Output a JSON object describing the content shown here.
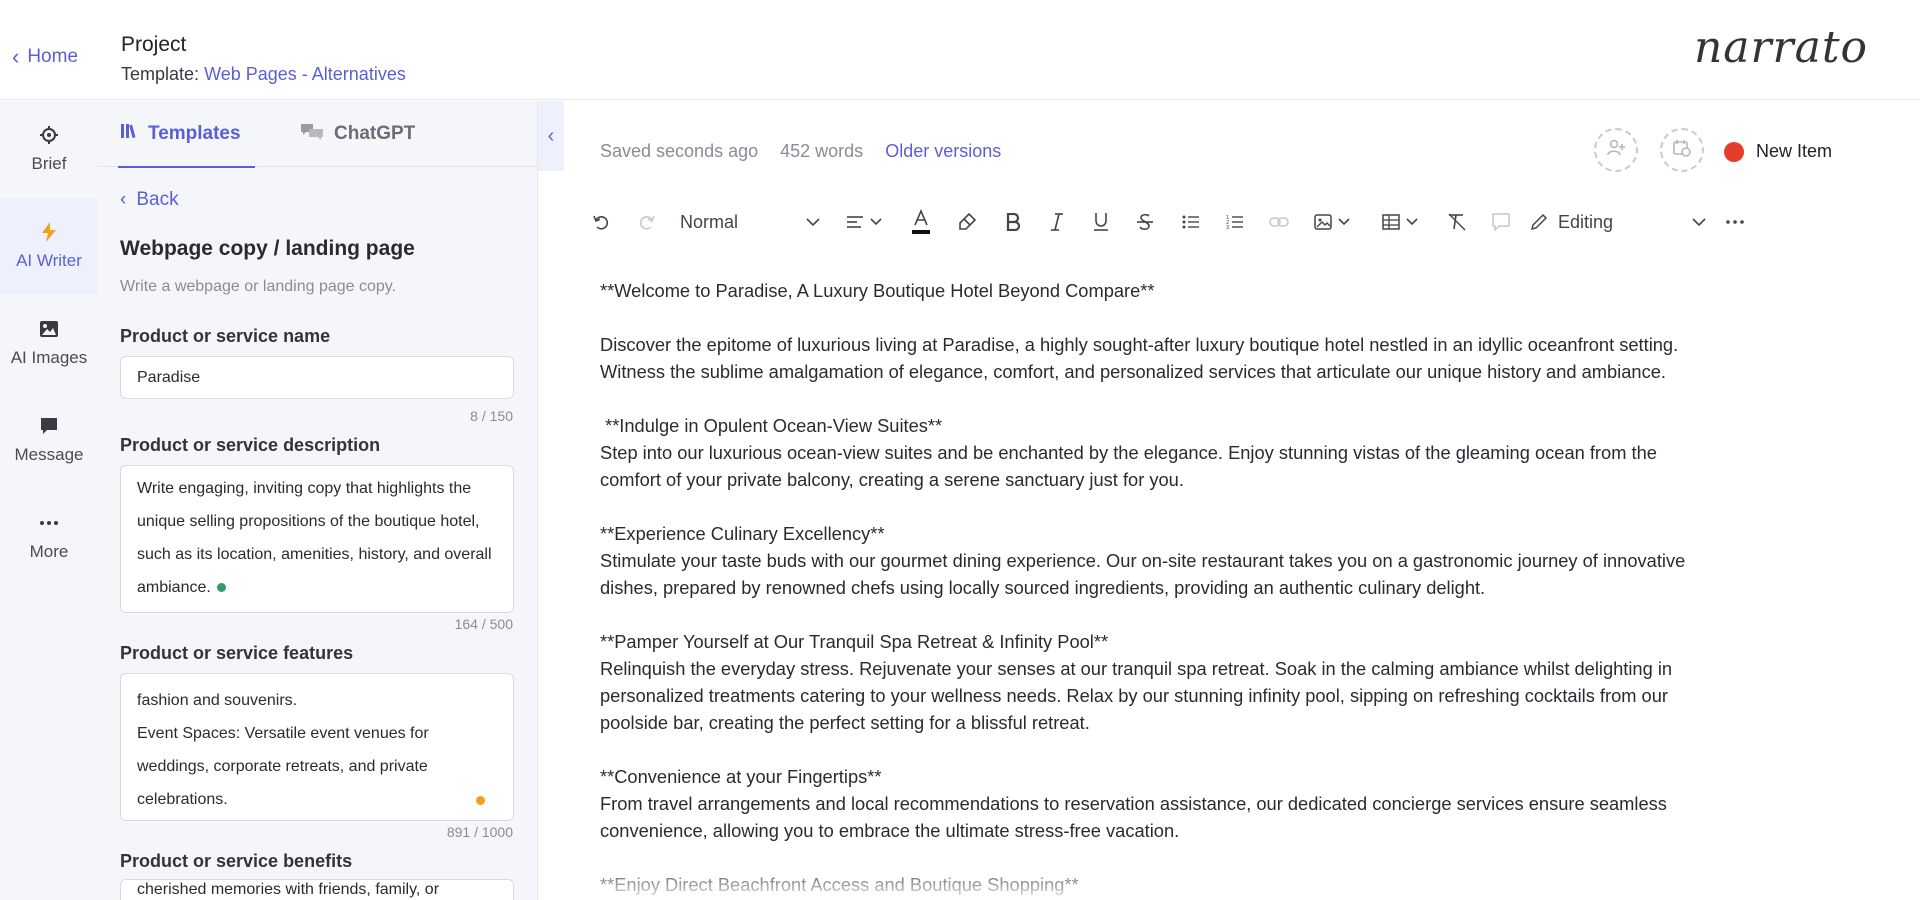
{
  "topbar": {
    "home": "Home",
    "project_title": "Project",
    "template_prefix": "Template:",
    "template_link": "Web Pages - Alternatives",
    "logo": "narrato"
  },
  "rail": {
    "items": [
      {
        "label": "Brief",
        "icon": "crosshair-icon"
      },
      {
        "label": "AI Writer",
        "icon": "bolt-icon"
      },
      {
        "label": "AI Images",
        "icon": "image-icon"
      },
      {
        "label": "Message",
        "icon": "chat-icon"
      },
      {
        "label": "More",
        "icon": "ellipsis-icon"
      }
    ],
    "active": "AI Writer"
  },
  "panel": {
    "tabs": [
      {
        "label": "Templates",
        "icon": "library-icon"
      },
      {
        "label": "ChatGPT",
        "icon": "chat-bubbles-icon"
      }
    ],
    "back": "Back",
    "title": "Webpage copy / landing page",
    "subtitle": "Write a webpage or landing page copy.",
    "fields": [
      {
        "label": "Product or service name",
        "value": "Paradise",
        "counter": "8 / 150"
      },
      {
        "label": "Product or service description",
        "value": "Write engaging, inviting copy that highlights the unique selling propositions of the boutique hotel, such as its location, amenities, history, and overall ambiance.",
        "counter": "164 / 500"
      },
      {
        "label": "Product or service features",
        "value_lines": [
          "fashion and souvenirs.",
          "Event Spaces: Versatile event venues for weddings, corporate retreats, and private celebrations."
        ],
        "counter": "891 / 1000"
      },
      {
        "label": "Product or service benefits",
        "value": "cherished memories with friends, family, or"
      }
    ]
  },
  "editor": {
    "saved": "Saved seconds ago",
    "words": "452 words",
    "older_versions": "Older versions",
    "status": "New Item",
    "status_color": "#e53c2b",
    "toolbar": {
      "style": "Normal",
      "mode": "Editing"
    },
    "paragraphs": [
      {
        "lines": [
          "**Welcome to Paradise, A Luxury Boutique Hotel Beyond Compare**"
        ]
      },
      {
        "lines": [
          "Discover the epitome of luxurious living at Paradise, a highly sought-after luxury boutique hotel nestled in an idyllic oceanfront setting.",
          "Witness the sublime amalgamation of elegance, comfort, and personalized services that articulate our unique history and ambiance."
        ]
      },
      {
        "lines": [
          " **Indulge in Opulent Ocean-View Suites**",
          "Step into our luxurious ocean-view suites and be enchanted by the elegance. Enjoy stunning vistas of the gleaming ocean from the",
          "comfort of your private balcony, creating a serene sanctuary just for you."
        ]
      },
      {
        "lines": [
          "**Experience Culinary Excellency**",
          "Stimulate your taste buds with our gourmet dining experience. Our on-site restaurant takes you on a gastronomic journey of innovative",
          "dishes, prepared by renowned chefs using locally sourced ingredients, providing an authentic culinary delight."
        ]
      },
      {
        "lines": [
          "**Pamper Yourself at Our Tranquil Spa Retreat & Infinity Pool**",
          "Relinquish the everyday stress. Rejuvenate your senses at our tranquil spa retreat. Soak in the calming ambiance whilst delighting in",
          "personalized treatments catering to your wellness needs. Relax by our stunning infinity pool, sipping on refreshing cocktails from our",
          "poolside bar, creating the perfect setting for a blissful retreat."
        ]
      },
      {
        "lines": [
          "**Convenience at your Fingertips**",
          "From travel arrangements and local recommendations to reservation assistance, our dedicated concierge services ensure seamless",
          "convenience, allowing you to embrace the ultimate stress-free vacation."
        ]
      },
      {
        "lines": [
          "**Enjoy Direct Beachfront Access and Boutique Shopping**"
        ]
      }
    ]
  }
}
